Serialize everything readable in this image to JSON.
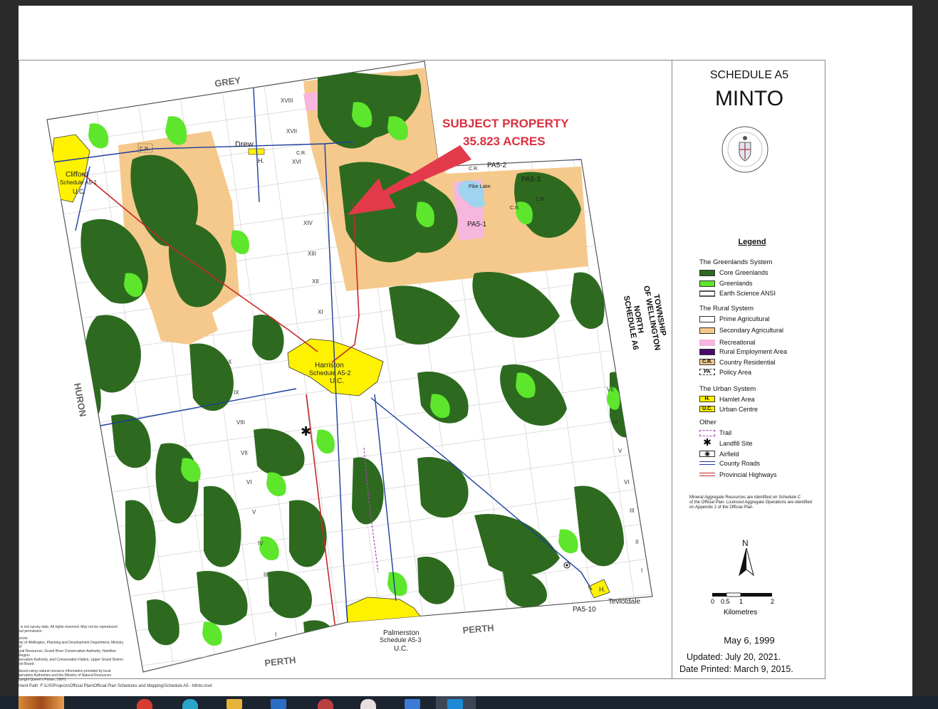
{
  "annotation": {
    "line1": "SUBJECT PROPERTY",
    "line2": "35.823 ACRES",
    "color": "#d9303f"
  },
  "map": {
    "labels": {
      "grey": "GREY",
      "huron": "HURON",
      "perth_left": "PERTH",
      "perth_right": "PERTH",
      "clifford": "Clifford",
      "clifford_sched": "Schedule A5-1",
      "clifford_uc": "U.C.",
      "harriston": "Harriston",
      "harriston_sched": "Schedule A5-2",
      "harriston_uc": "U.C.",
      "palmerston": "Palmerston",
      "palmerston_sched": "Schedule A5-3",
      "palmerston_uc": "U.C.",
      "drew": "Drew",
      "drew_h": "H.",
      "teviotdale": "Teviotdale",
      "teviotdale_h": "H.",
      "pa5_1": "PA5-1",
      "pa5_2": "PA5-2",
      "pa5_3": "PA5-3",
      "pa5_10": "PA5-10",
      "pike_lake": "Pike Lake",
      "cr": "C.R.",
      "township_l1": "TOWNSHIP",
      "township_l2": "OF WELLINGTON",
      "township_l3": "NORTH",
      "township_l4": "SCHEDULE A6",
      "roman": [
        "XVIII",
        "XVII",
        "XVI",
        "XIV",
        "XIII",
        "XII",
        "XI",
        "X",
        "IX",
        "VIII",
        "VII",
        "VI",
        "V",
        "IV",
        "III",
        "II",
        "I",
        "VII",
        "VI",
        "V",
        "VI",
        "III",
        "II",
        "I"
      ]
    },
    "colors": {
      "core": "#2d6a1f",
      "green": "#5de62c",
      "secondary": "#f5c98c",
      "recreational": "#f6b6dd",
      "urban": "#fff200",
      "county_road": "#1c3d9b",
      "highway": "#c62828",
      "trail": "#b03fbf"
    }
  },
  "footer": {
    "left_notes": [
      ". is not survey data. All rights reserved. May not be reproduced",
      "out permission.",
      "urces:",
      "nty of Wellington, Planning and Development Department, Ministry of",
      "ural Resources, Grand River Conservation Authority, Hamilton Region",
      "servation Authority, and Conservation Halton, Upper Grand District",
      "ool Board.",
      "duced using natural resource information provided by local",
      "servation Authorities and the Ministry of Natural Resources",
      "pyright Queen's Printer, 1997)."
    ],
    "path": "ment Path: F:\\LIS\\Projects\\Official Plan\\Official Plan Schedules and Mapping\\Schedule A5 - Minto.mxd"
  },
  "panel": {
    "schedule": "SCHEDULE A5",
    "name": "MINTO",
    "legend_title": "Legend",
    "groups": {
      "greenlands": "The Greenlands System",
      "rural": "The Rural System",
      "urban": "The Urban System",
      "other": "Other"
    },
    "items": {
      "core_greenlands": "Core Greenlands",
      "greenlands": "Greenlands",
      "earth_science": "Earth Science ANSI",
      "prime_ag": "Prime Agricultural",
      "secondary_ag": "Secondary Agricultural",
      "recreational": "Recreational",
      "rural_employment": "Rural Employment Area",
      "country_res": "Country Residential",
      "country_res_sw": "C.R.",
      "policy_area": "Policy Area",
      "policy_area_sw": "PA",
      "hamlet": "Hamlet Area",
      "hamlet_sw": "H.",
      "urban_centre": "Urban Centre",
      "urban_centre_sw": "U.C.",
      "trail": "Trail",
      "landfill": "Landfill Site",
      "airfield": "Airfield",
      "county_roads": "County Roads",
      "provincial_hwy": "Provincial Highways"
    },
    "note": [
      "Mineral Aggregate Resources are identified on Schedule C",
      "of the Official Plan. Licensed Aggregate Operations are identified",
      "on Appendix 2 of the Official Plan."
    ],
    "north": "N",
    "scale": {
      "ticks": [
        "0",
        "0.5",
        "1",
        "2"
      ],
      "unit": "Kilometres"
    },
    "date": "May 6, 1999",
    "updated": "Updated:  July 20, 2021.",
    "printed": "Date Printed:  March 9, 2015."
  }
}
